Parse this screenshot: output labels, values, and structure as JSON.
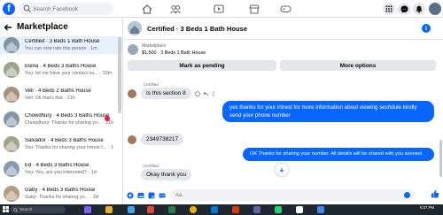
{
  "nav": {
    "logo": "f",
    "search_placeholder": "Search Facebook",
    "tabs": [
      "home-icon",
      "friends-icon",
      "watch-icon",
      "marketplace-icon",
      "gaming-icon"
    ],
    "right_icons": [
      "menu-grid-icon",
      "messenger-icon",
      "bell-icon"
    ]
  },
  "sidebar": {
    "title": "Marketplace",
    "conversations": [
      {
        "name": "Certified · 3 Beds 1 Bath House",
        "preview": "You can now rate this person · 1m",
        "active": true
      },
      {
        "name": "Elena · 4 Beds 3 Baths House",
        "preview": "You: let me have your contact nu... · 13m"
      },
      {
        "name": "Vell · 4 Beds 2 Baths House",
        "preview": "Vell: Ok that's fine · 21h"
      },
      {
        "name": "Chowdhury · 4 Beds 3 Baths House",
        "preview": "Chowdhury: Thanks for sharing yo... · 21h",
        "unread": true
      },
      {
        "name": "Salvador · 4 Beds 3 Baths House",
        "preview": "You: Thanks for sharing your intrest f... · 1d"
      },
      {
        "name": "Ed · 4 Beds 3 Baths House",
        "preview": "You: Yes, are you interested? · 1d"
      },
      {
        "name": "Gaby · 4 Beds 3 Baths House",
        "preview": "Gaby: Thanks for sharing yo... · 2d"
      }
    ]
  },
  "chat": {
    "title": "Certified · 3 Beds 1 Bath House",
    "listing_source": "Marketplace",
    "listing_price": "$1,500 · 3 Beds 1 Bath House",
    "mark_pending_label": "Mark as pending",
    "more_options_label": "More options",
    "sender_label": "Certified",
    "messages": {
      "m1": "Is this section 8",
      "m2": "yes thanks for your intrest for more information about viewing sechdule kindly send your phone number",
      "m3": "2349738217",
      "m4": "OK Thanks for sharing your number. All details will be shared with you soonest",
      "m5": "Okay thank you"
    },
    "composer_placeholder": "Aa"
  },
  "taskbar": {
    "search": "Search",
    "time": "6:57 PM"
  },
  "colors": {
    "brand": "#0866ff",
    "bubble_in": "#e4e6eb",
    "unread": "#e41e3f"
  }
}
